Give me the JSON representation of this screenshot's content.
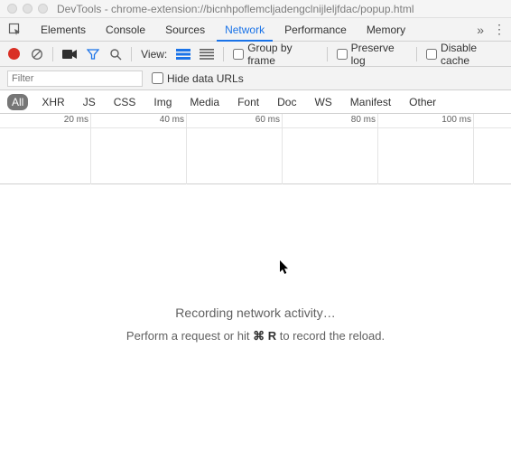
{
  "window": {
    "title": "DevTools - chrome-extension://bicnhpoflemcljadengclnijleljfdac/popup.html"
  },
  "tabs": {
    "items": [
      "Elements",
      "Console",
      "Sources",
      "Network",
      "Performance",
      "Memory"
    ],
    "active_index": 3
  },
  "toolbar": {
    "view_label": "View:",
    "group_by_frame": "Group by frame",
    "preserve_log": "Preserve log",
    "disable_cache": "Disable cache"
  },
  "filterbar": {
    "filter_placeholder": "Filter",
    "hide_data_urls": "Hide data URLs"
  },
  "filter_types": [
    "All",
    "XHR",
    "JS",
    "CSS",
    "Img",
    "Media",
    "Font",
    "Doc",
    "WS",
    "Manifest",
    "Other"
  ],
  "filter_types_active_index": 0,
  "timeline": {
    "ticks": [
      "20 ms",
      "40 ms",
      "60 ms",
      "80 ms",
      "100 ms"
    ]
  },
  "content": {
    "recording": "Recording network activity…",
    "hint_prefix": "Perform a request or hit ",
    "hint_key": "⌘ R",
    "hint_suffix": " to record the reload."
  }
}
